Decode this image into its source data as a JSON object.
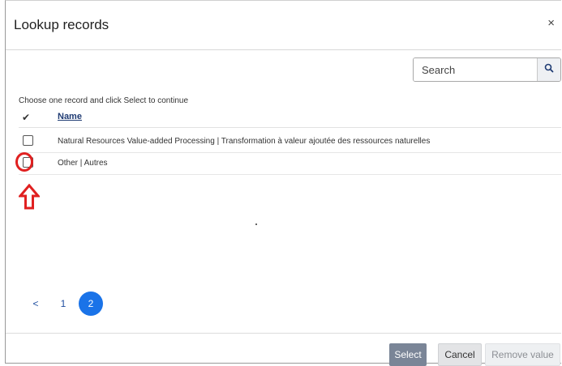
{
  "dialog": {
    "title": "Lookup records",
    "close_label": "×"
  },
  "search": {
    "placeholder": "Search",
    "value": ""
  },
  "instruction": "Choose one record and click Select to continue",
  "table": {
    "select_col_icon": "✔",
    "name_header": "Name",
    "rows": [
      {
        "name": "Natural Resources Value-added Processing | Transformation à valeur ajoutée des ressources naturelles",
        "checked": false
      },
      {
        "name": "Other | Autres",
        "checked": false
      }
    ]
  },
  "pagination": {
    "prev_label": "<",
    "pages": [
      "1",
      "2"
    ],
    "current_page": "2"
  },
  "footer": {
    "select_label": "Select",
    "cancel_label": "Cancel",
    "remove_label": "Remove value"
  },
  "annotation": {
    "color": "#e02020",
    "shapes": [
      "circle",
      "arrow-up-icon"
    ]
  },
  "colors": {
    "accent": "#1a73e8",
    "select_button": "#7a8597",
    "header_link": "#1f3b73"
  }
}
